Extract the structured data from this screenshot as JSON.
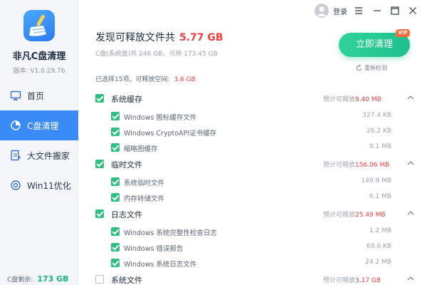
{
  "app": {
    "name": "非凡C盘清理",
    "version": "版本: V1.0.29.76"
  },
  "nav": [
    {
      "label": "首页",
      "icon": "computer-icon",
      "active": false
    },
    {
      "label": "C盘清理",
      "icon": "disk-icon",
      "active": true
    },
    {
      "label": "大文件搬家",
      "icon": "folder-move-icon",
      "active": false
    },
    {
      "label": "Win11优化",
      "icon": "optimize-icon",
      "active": false
    }
  ],
  "disk": {
    "label": "C盘剩余:",
    "value": "173 GB"
  },
  "titlebar": {
    "login": "登录"
  },
  "header": {
    "prefix": "发现可释放文件共",
    "size": "5.77 GB",
    "disk_info": "C盘(系统盘)共 246 GB，可用 173.45 GB",
    "clean_button": "立即清理",
    "vip_badge": "VIP",
    "rescan": "重新检测",
    "selected_prefix": "已选择15项，可释放空间:",
    "selected_size": "3.6 GB"
  },
  "estimate_label": "预计可释放",
  "groups": [
    {
      "name": "系统缓存",
      "checked": true,
      "size": "9.40 MB",
      "items": [
        {
          "name": "Windows 图标缓存文件",
          "size": "327.4 KB",
          "checked": true
        },
        {
          "name": "Windows CryptoAPI证书缓存",
          "size": "26.2 KB",
          "checked": true
        },
        {
          "name": "缩略图缓存",
          "size": "9.1 MB",
          "checked": true
        }
      ]
    },
    {
      "name": "临时文件",
      "checked": true,
      "size": "156.06 MB",
      "items": [
        {
          "name": "系统临时文件",
          "size": "149.9 MB",
          "checked": true
        },
        {
          "name": "内存转储文件",
          "size": "6.1 MB",
          "checked": true
        }
      ]
    },
    {
      "name": "日志文件",
      "checked": true,
      "size": "25.49 MB",
      "items": [
        {
          "name": "Windows 系统完整性检查日志",
          "size": "1.2 MB",
          "checked": true
        },
        {
          "name": "Windows 错误报告",
          "size": "69.0 KB",
          "checked": true
        },
        {
          "name": "Windows 系统日志文件",
          "size": "24.2 MB",
          "checked": true
        }
      ]
    },
    {
      "name": "系统文件",
      "checked": false,
      "size": "3.17 GB",
      "items": []
    }
  ],
  "colors": {
    "accent": "#3a8bf7",
    "green": "#2fbf80",
    "red": "#ef3d3d"
  }
}
